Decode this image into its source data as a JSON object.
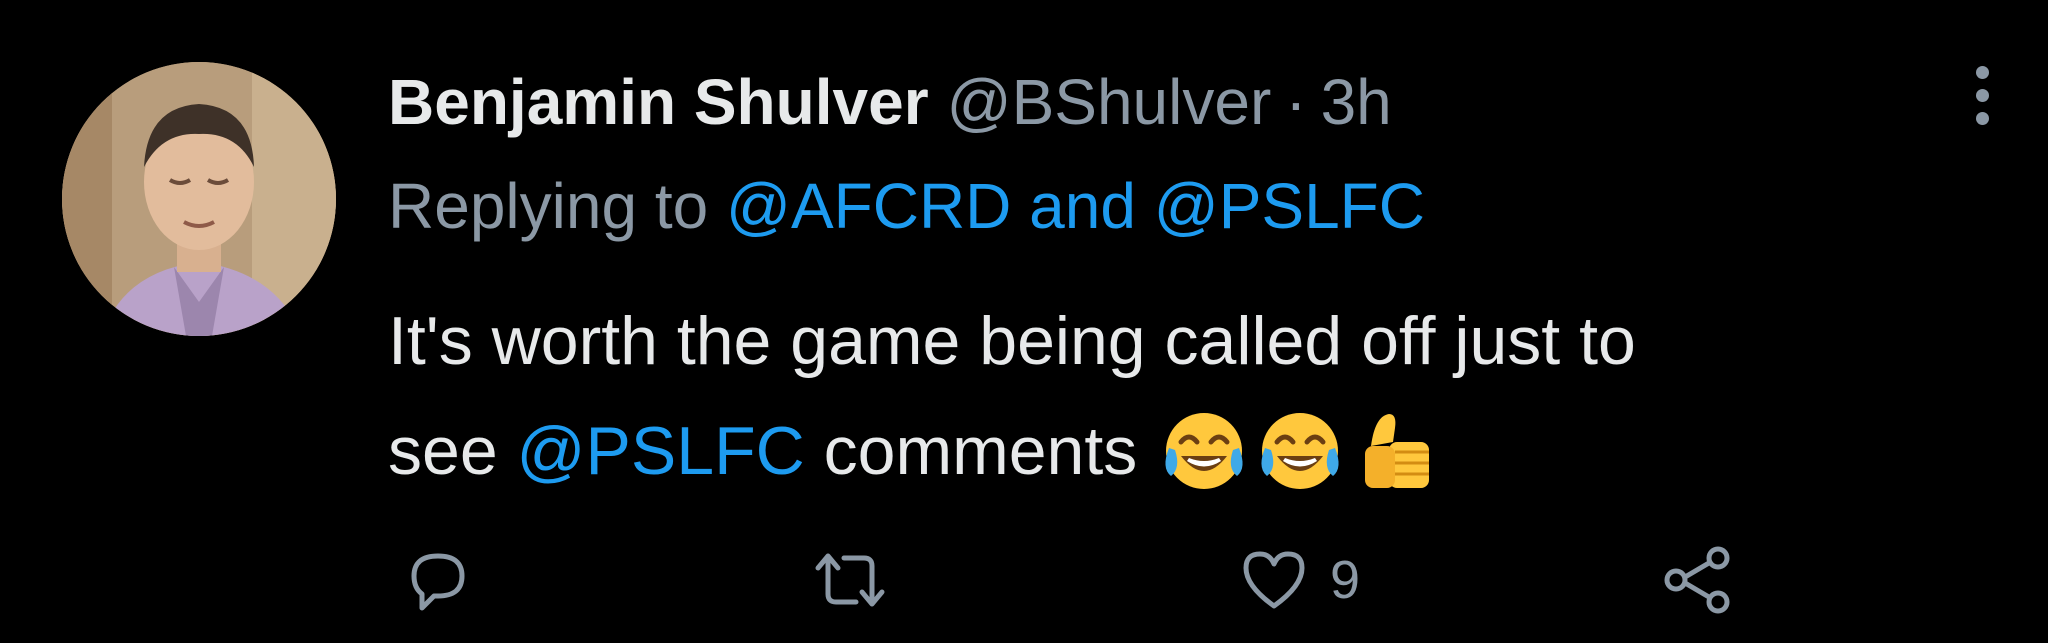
{
  "tweet": {
    "author": {
      "display_name": "Benjamin Shulver",
      "handle": "@BShulver",
      "separator": "·",
      "time": "3h"
    },
    "replying": {
      "prefix": "Replying to ",
      "mention_1": "@AFCRD",
      "conjunction": " and ",
      "mention_2": "@PSLFC"
    },
    "text": {
      "line1": "It's worth the game being called off just to",
      "line2_prefix": "see ",
      "line2_mention": "@PSLFC",
      "line2_suffix": " comments"
    },
    "emojis": [
      "face-with-tears-of-joy",
      "face-with-tears-of-joy",
      "thumbs-up"
    ],
    "actions": {
      "reply_icon": "reply-icon",
      "retweet_icon": "retweet-icon",
      "like_icon": "heart-icon",
      "like_count": "9",
      "share_icon": "share-icon"
    }
  },
  "colors": {
    "background": "#000000",
    "primary_text": "#e7e9ea",
    "secondary_text": "#8b98a5",
    "mention": "#1d9bf0",
    "emoji_yellow": "#ffc83d"
  }
}
